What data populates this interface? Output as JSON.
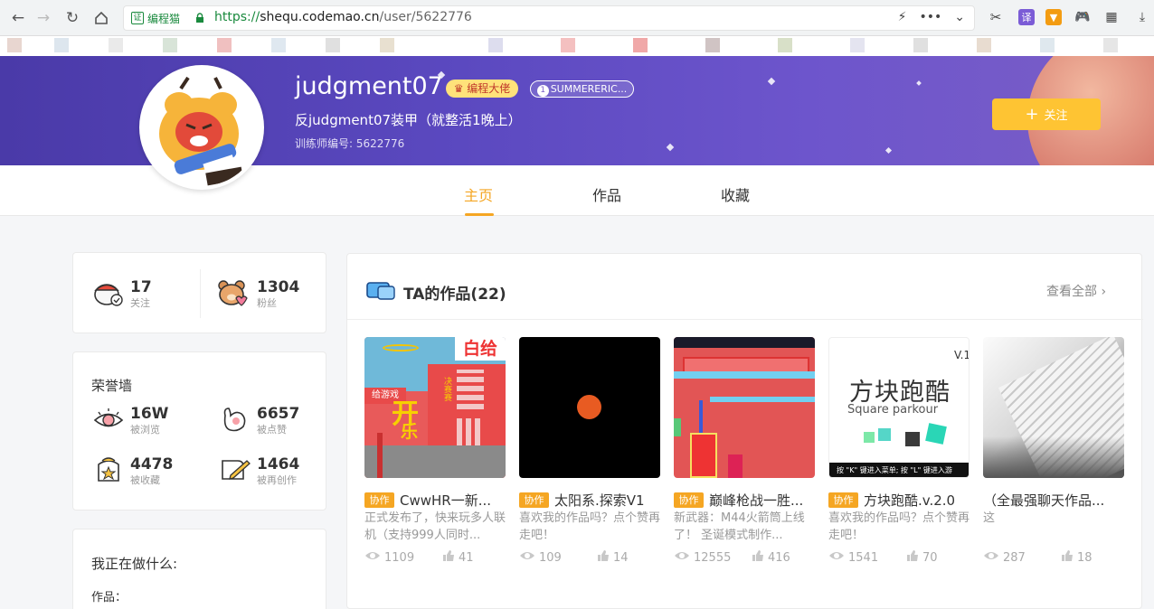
{
  "browser": {
    "site_label": "编程猫",
    "url_protocol": "https://",
    "url_host": "shequ.codemao.cn",
    "url_path": "/user/5622776"
  },
  "profile": {
    "username": "judgment07",
    "badge_level": "编程大佬",
    "badge_tag": "SUMMERERIC...",
    "badge_tag_prefix": "1",
    "bio": "反judgment07装甲（就整活1晚上）",
    "trainer_id": "训练师编号: 5622776",
    "follow_label": "关注"
  },
  "tabs": [
    {
      "label": "主页"
    },
    {
      "label": "作品"
    },
    {
      "label": "收藏"
    }
  ],
  "follow_stats": {
    "following": {
      "value": "17",
      "label": "关注"
    },
    "followers": {
      "value": "1304",
      "label": "粉丝"
    }
  },
  "honor": {
    "title": "荣誉墙",
    "items": [
      {
        "value": "16W",
        "label": "被浏览"
      },
      {
        "value": "6657",
        "label": "被点赞"
      },
      {
        "value": "4478",
        "label": "被收藏"
      },
      {
        "value": "1464",
        "label": "被再创作"
      }
    ]
  },
  "doing": {
    "title": "我正在做什么:",
    "line1": "作品："
  },
  "works": {
    "title": "TA的作品(22)",
    "view_all": "查看全部",
    "items": [
      {
        "tag": "协作",
        "name": "CwwHR一新...",
        "desc": "正式发布了，快来玩多人联机（支持999人同时...",
        "views": "1109",
        "likes": "41"
      },
      {
        "tag": "协作",
        "name": "太阳系.探索V1",
        "desc": "喜欢我的作品吗？点个赞再走吧！",
        "views": "109",
        "likes": "14"
      },
      {
        "tag": "协作",
        "name": "巅峰枪战一胜...",
        "desc": "新武器：M44火箭筒上线了！ 圣诞模式制作...",
        "views": "12555",
        "likes": "416"
      },
      {
        "tag": "协作",
        "name": "方块跑酷.v.2.0",
        "desc": "喜欢我的作品吗？点个赞再走吧！",
        "views": "1541",
        "likes": "70"
      },
      {
        "tag": "",
        "name": "（全最强聊天作品...",
        "desc": "这",
        "views": "287",
        "likes": "18"
      }
    ]
  },
  "thumb_text": {
    "t1_big": "白给",
    "t1_sign": "给游戏",
    "t1_a": "开",
    "t1_b": "乐",
    "t1_c": "决赛赛",
    "t4_title": "方块跑酷",
    "t4_sub": "Square parkour",
    "t4_ver": "V.1",
    "t4_hint": "按 \"K\" 键进入菜单; 按 \"L\" 键进入游"
  },
  "colors": {
    "accent": "#f5a623",
    "banner": "#5b49c0",
    "follow": "#fec433"
  }
}
